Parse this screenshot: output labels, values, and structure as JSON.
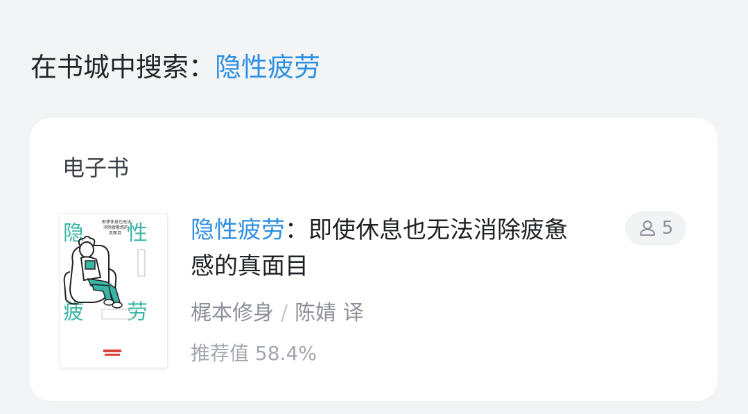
{
  "search": {
    "prefix": "在书城中搜索：",
    "query": "隐性疲劳"
  },
  "section": {
    "title": "电子书"
  },
  "book": {
    "title_highlight": "隐性疲劳",
    "title_rest": "：即使休息也无法消除疲惫感的真面目",
    "author": "梶本修身",
    "separator": "/",
    "translator": "陈婧 译",
    "rating_label": "推荐值",
    "rating_value": "58.4%",
    "readers_count": "5",
    "reader_icon": "user-icon",
    "cover": {
      "chars": [
        "隐",
        "性",
        "疲",
        "劳"
      ],
      "tagline_lines": [
        "即使休息也无法",
        "消除疲惫感的",
        "真面目"
      ],
      "accent_color": "#3ab5a4"
    }
  },
  "colors": {
    "accent": "#2f8fe0",
    "background": "#f3f4f6",
    "card": "#ffffff"
  }
}
